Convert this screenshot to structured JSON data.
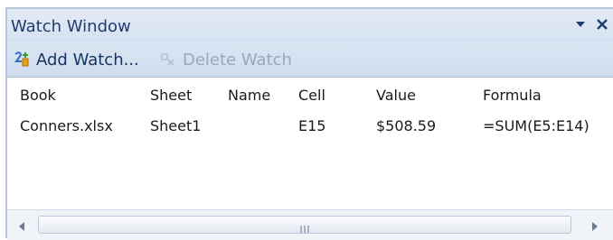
{
  "window": {
    "title": "Watch Window",
    "controls": {
      "dropdown_icon": "chevron-down-icon",
      "close_icon": "close-icon"
    }
  },
  "toolbar": {
    "add_watch_label": "Add Watch...",
    "add_watch_icon": "add-watch-icon",
    "delete_watch_label": "Delete Watch",
    "delete_watch_icon": "delete-watch-icon",
    "delete_enabled": false
  },
  "table": {
    "columns": [
      "Book",
      "Sheet",
      "Name",
      "Cell",
      "Value",
      "Formula"
    ],
    "rows": [
      {
        "book": "Conners.xlsx",
        "sheet": "Sheet1",
        "name": "",
        "cell": "E15",
        "value": "$508.59",
        "formula": "=SUM(E5:E14)"
      }
    ]
  },
  "scrollbar": {
    "left_icon": "scroll-left-icon",
    "right_icon": "scroll-right-icon",
    "grip_icon": "grip-icon"
  },
  "colors": {
    "title_text": "#1f3c6e",
    "toolbar_bg": "#d6e2f1",
    "disabled_text": "#9aa7b8"
  }
}
